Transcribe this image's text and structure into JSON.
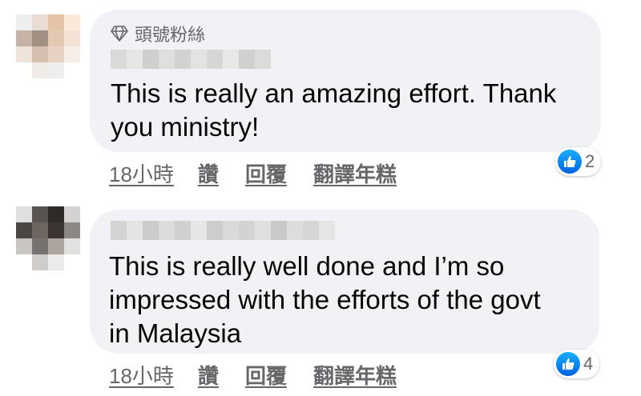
{
  "comments": [
    {
      "badge": "頭號粉絲",
      "text_lines": [
        "This is really an amazing effort. Thank",
        "you ministry!"
      ],
      "time": "18小時",
      "like": "讚",
      "reply": "回覆",
      "translate": "翻譯年糕",
      "reactions": "2"
    },
    {
      "text_lines": [
        "This is really well done and I’m so",
        "impressed with the efforts of the govt",
        "in Malaysia"
      ],
      "time": "18小時",
      "like": "讚",
      "reply": "回覆",
      "translate": "翻譯年糕",
      "reactions": "4"
    }
  ],
  "icons": {
    "badge": "diamond-icon",
    "reaction": "like-thumb-icon"
  },
  "colors": {
    "bubble": "#f0f2f5",
    "text": "#050505",
    "secondary": "#65676b",
    "like_blue": "#1877f2"
  }
}
